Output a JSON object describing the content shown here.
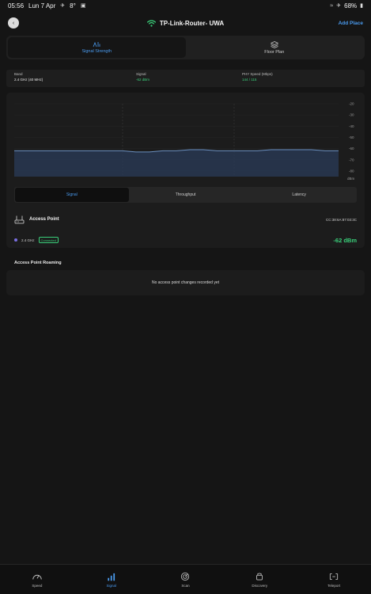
{
  "status_bar": {
    "time": "05:56",
    "date": "Lun 7 Apr",
    "temp": "8°",
    "battery": "68%"
  },
  "header": {
    "title": "TP-Link-Router- UWA",
    "action": "Add Place"
  },
  "mode_tabs": [
    {
      "label": "Signal Strength",
      "active": true
    },
    {
      "label": "Floor Plan",
      "active": false
    }
  ],
  "info": {
    "band_label": "Band",
    "band_value": "2.4 GHz (40 MHz)",
    "signal_label": "Signal",
    "signal_value": "-62 dBm",
    "phy_label": "PHY Speed (Mbps)",
    "phy_value": "144 / 115"
  },
  "chart_data": {
    "type": "line",
    "ylabel": "dBm",
    "yticks": [
      "-20",
      "-30",
      "-40",
      "-50",
      "-60",
      "-70",
      "-80"
    ],
    "ylim": [
      -85,
      -20
    ],
    "series": [
      {
        "values": [
          -62,
          -62,
          -62,
          -62,
          -62,
          -62,
          -62,
          -62,
          -62,
          -63,
          -63,
          -62,
          -62,
          -61,
          -61,
          -62,
          -62,
          -62,
          -62,
          -61,
          -61,
          -61,
          -61,
          -62,
          -62
        ]
      }
    ],
    "colors": {
      "line": "#6a8fbf",
      "fill": "#2a3b58"
    }
  },
  "chart_tabs": [
    {
      "label": "Signal",
      "active": true
    },
    {
      "label": "Throughput",
      "active": false
    },
    {
      "label": "Latency",
      "active": false
    }
  ],
  "access_point": {
    "title": "Access Point",
    "mac": "CC:38:6A:87:03:3C",
    "band": "2.4 GHz",
    "badge": "Connected",
    "signal": "-62 dBm"
  },
  "roaming": {
    "title": "Access Point Roaming",
    "empty_text": "No access point changes recorded yet"
  },
  "bottom_nav": [
    {
      "label": "Speed",
      "icon": "speedometer-icon",
      "active": false
    },
    {
      "label": "Signal",
      "icon": "signal-bars-icon",
      "active": true
    },
    {
      "label": "Scan",
      "icon": "radar-icon",
      "active": false
    },
    {
      "label": "Discovery",
      "icon": "android-icon",
      "active": false
    },
    {
      "label": "Teleport",
      "icon": "teleport-icon",
      "active": false
    }
  ]
}
